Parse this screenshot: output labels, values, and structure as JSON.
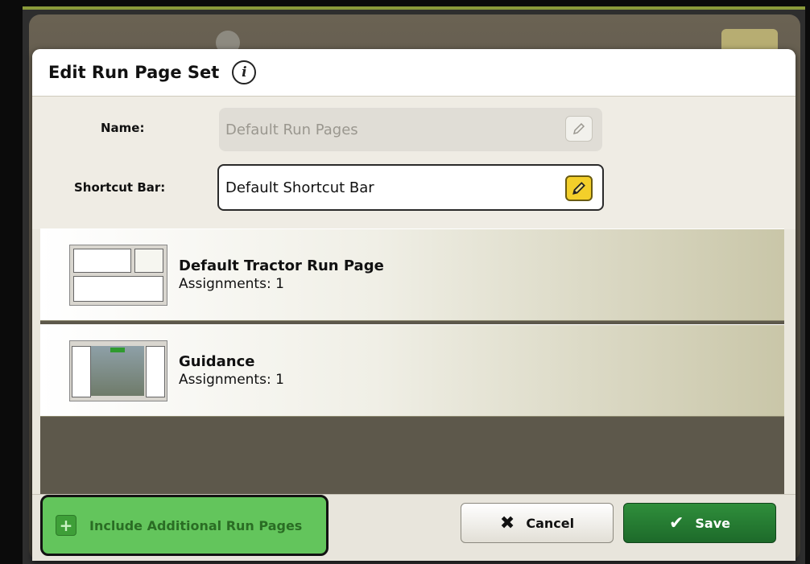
{
  "dialog": {
    "title": "Edit Run Page Set",
    "info_icon": "i"
  },
  "form": {
    "name_label": "Name:",
    "name_value": "Default Run Pages",
    "shortcut_label": "Shortcut Bar:",
    "shortcut_value": "Default Shortcut Bar"
  },
  "run_pages": [
    {
      "title": "Default Tractor Run Page",
      "assignments": "Assignments: 1"
    },
    {
      "title": "Guidance",
      "assignments": "Assignments: 1"
    }
  ],
  "footer": {
    "include_label": "Include Additional Run Pages",
    "cancel_label": "Cancel",
    "save_label": "Save"
  },
  "icons": {
    "info": "info-icon",
    "edit": "pencil-icon",
    "plus": "plus-icon",
    "cancel": "x-icon",
    "save": "checkmark-icon"
  },
  "colors": {
    "edit_active": "#f3cf2a",
    "include_button": "#63c55c",
    "save_button": "#1d6a2a"
  }
}
